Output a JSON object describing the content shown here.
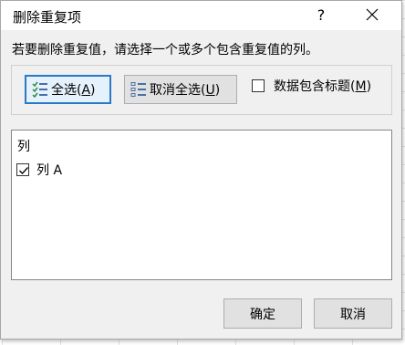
{
  "dialog": {
    "title": "删除重复项",
    "help_label": "?",
    "prompt": "若要删除重复值，请选择一个或多个包含重复值的列。"
  },
  "toolbar": {
    "select_all_text": "全选(",
    "select_all_key": "A",
    "unselect_all_text": "取消全选(",
    "unselect_all_key": "U",
    "close_paren": ")",
    "header_label_text": "数据包含标题(",
    "header_label_key": "M",
    "header_checked": false
  },
  "columns": {
    "header": "列",
    "items": [
      {
        "label": "列 A",
        "checked": true
      }
    ]
  },
  "footer": {
    "ok_label": "确定",
    "cancel_label": "取消"
  },
  "colors": {
    "accent_border": "#2a79c8",
    "dialog_bg": "#f0f0f0"
  }
}
